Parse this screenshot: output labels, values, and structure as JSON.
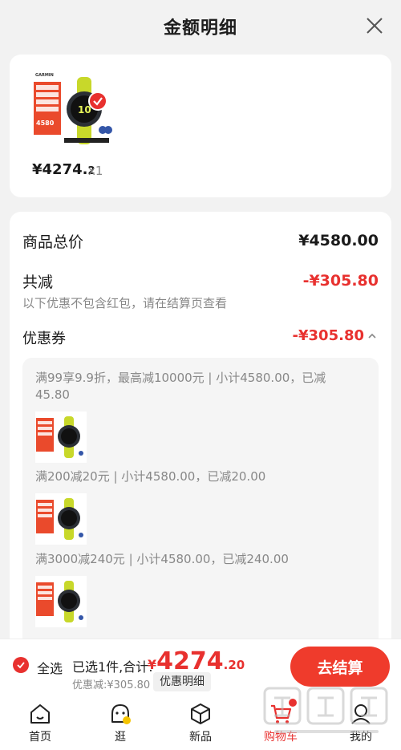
{
  "header": {
    "title": "金额明细"
  },
  "product": {
    "brand": "GARMIN",
    "price_main": "¥4274.",
    "price_dec": "2",
    "quantity": "x1",
    "thumb_price": "4580"
  },
  "detail": {
    "goods_total_label": "商品总价",
    "goods_total_value": "¥4580.00",
    "reduce_label": "共减",
    "reduce_value": "-¥305.80",
    "reduce_note": "以下优惠不包含红包，请在结算页查看",
    "coupon_label": "优惠券",
    "coupon_value": "-¥305.80",
    "coupon_lines": [
      "满99享9.9折，最高减10000元 | 小计4580.00，已减",
      "45.80",
      "满200减20元 | 小计4580.00，已减20.00",
      "满3000减240元 | 小计4580.00，已减240.00"
    ]
  },
  "bottom": {
    "select_all": "全选",
    "summary": "已选1件,合计:",
    "total_sym": "¥",
    "total_int": "4274",
    "total_dec": ".20",
    "discount_note": "优惠减:¥305.80",
    "detail_button": "优惠明细",
    "checkout": "去结算"
  },
  "tabs": [
    {
      "label": "首页",
      "icon": "home-icon"
    },
    {
      "label": "逛",
      "icon": "stroll-icon"
    },
    {
      "label": "新品",
      "icon": "new-products-icon"
    },
    {
      "label": "购物车",
      "icon": "cart-icon"
    },
    {
      "label": "我的",
      "icon": "profile-icon"
    }
  ],
  "colors": {
    "accent": "#e8312f",
    "button": "#ef3b2c",
    "watch_band": "#c8d82a"
  }
}
